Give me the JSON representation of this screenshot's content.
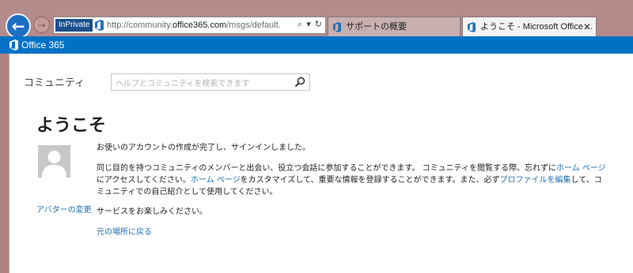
{
  "browser": {
    "inprivate_label": "InPrivate",
    "url_prefix": "http://community.",
    "url_domain": "office365.com",
    "url_suffix": "/msgs/default.",
    "tabs": [
      {
        "label": "サポートの概要"
      },
      {
        "label": "ようこそ - Microsoft Office ...",
        "close": "✕"
      }
    ]
  },
  "suitebar": {
    "brand": "Office 365",
    "color": "#0072c6"
  },
  "page": {
    "community_title": "コミュニティ",
    "search_placeholder": "ヘルプとコミュニティを検索できます",
    "heading": "ようこそ",
    "avatar_change": "アバターの変更",
    "message_1": "お使いのアカウントの作成が完了し、サインインしました。",
    "message_2_part1": "同じ目的を持つコミュニティのメンバーと出会い、役立つ会話に参加することができます。 コミュニティを閲覧する際、忘れずに",
    "link_home_1": "ホーム ページ",
    "message_2_part2": "にアクセスしてください。",
    "link_home_2": "ホーム ページ",
    "message_2_part3": "をカスタマイズして、重要な情報を登録することができます。また、必ず",
    "link_profile": "プロファイルを編集",
    "message_2_part4": "して、コミュニティでの自己紹介として使用してください。",
    "message_3": "サービスをお楽しみください。",
    "back_link": "元の場所に戻る"
  }
}
